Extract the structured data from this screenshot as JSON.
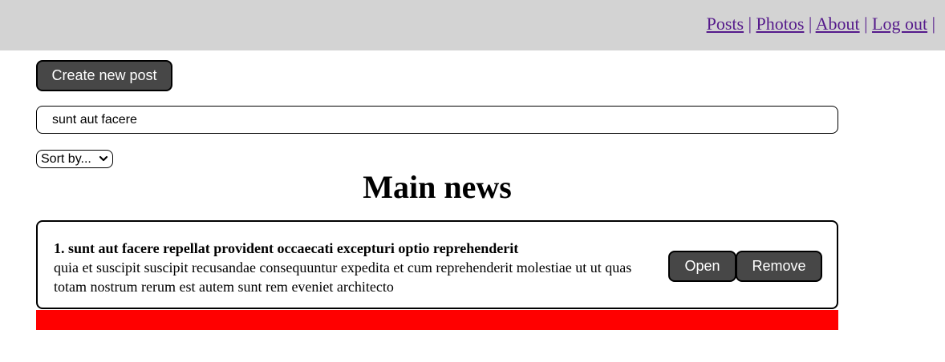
{
  "navbar": {
    "links": [
      "Posts",
      "Photos",
      "About",
      "Log out"
    ],
    "separator": "|",
    "background_color": "#d3d3d3",
    "link_color": "#551a8b"
  },
  "create_button": {
    "label": "Create new post"
  },
  "search": {
    "value": "sunt aut facere",
    "placeholder": ""
  },
  "sort": {
    "selected": "Sort by..."
  },
  "main": {
    "title": "Main news"
  },
  "posts": [
    {
      "title": "1. sunt aut facere repellat provident occaecati excepturi optio reprehenderit",
      "body": "quia et suscipit suscipit recusandae consequuntur expedita et cum reprehenderit molestiae ut ut quas totam nostrum rerum est autem sunt rem eveniet architecto",
      "open_label": "Open",
      "remove_label": "Remove"
    }
  ],
  "colors": {
    "button_bg": "#474747",
    "highlight_bar": "#ff0000"
  }
}
